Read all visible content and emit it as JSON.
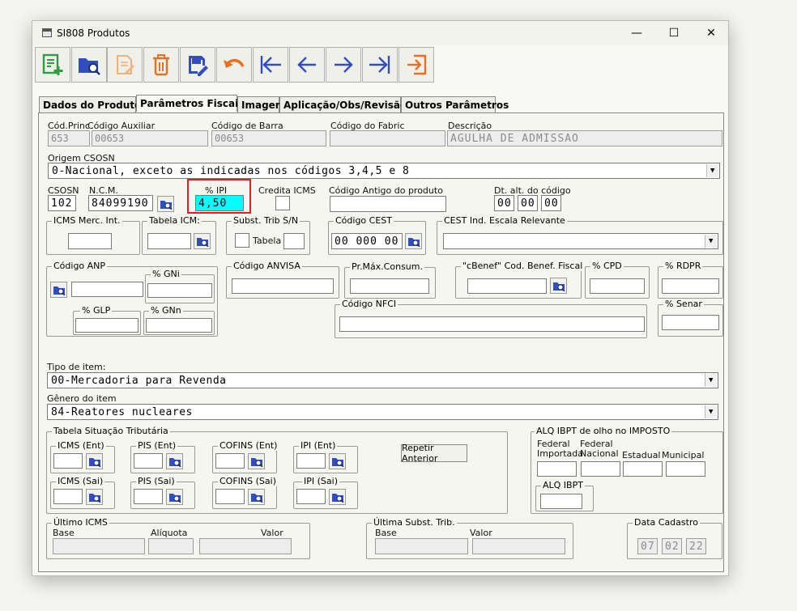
{
  "window": {
    "title": "SI808 Produtos",
    "minimize": "—",
    "maximize": "☐",
    "close": "✕"
  },
  "toolbar": {
    "buttons": [
      "new-record",
      "search-record",
      "edit-record",
      "delete-record",
      "save-record",
      "undo",
      "first-record",
      "previous-record",
      "next-record",
      "last-record",
      "exit"
    ]
  },
  "tabs": [
    "Dados do  Produto",
    "Parâmetros Fiscais",
    "Imagem",
    "Aplicação/Obs/Revisão",
    "Outros Parâmetros"
  ],
  "fields": {
    "cod_princ": {
      "label": "Cód.Princ",
      "value": "653"
    },
    "cod_auxiliar": {
      "label": "Código Auxiliar",
      "value": "00653"
    },
    "cod_barra": {
      "label": "Código de Barra",
      "value": "00653"
    },
    "cod_fabric": {
      "label": "Código do Fabric",
      "value": ""
    },
    "descricao": {
      "label": "Descrição",
      "value": "AGULHA DE ADMISSAO"
    },
    "origem": {
      "label": "Origem CSOSN",
      "value": "0-Nacional, exceto as indicadas nos códigos 3,4,5 e 8"
    },
    "csosn": {
      "label": "CSOSN",
      "value": "102"
    },
    "ncm": {
      "label": "N.C.M.",
      "value": "84099190"
    },
    "ipi": {
      "label": "% IPI",
      "value": "4,50"
    },
    "credita_icms": {
      "label": "Credita ICMS"
    },
    "cod_antigo": {
      "label": "Código Antigo do produto",
      "value": ""
    },
    "dt_alt": {
      "label": "Dt. alt. do código",
      "d": "00",
      "m": "00",
      "y": "00"
    },
    "icms_merc": {
      "label": "ICMS Merc. Int."
    },
    "tabela_icm": {
      "label": "Tabela ICM:"
    },
    "subst_trib": {
      "label": "Subst. Trib S/N",
      "tabela": "Tabela"
    },
    "cod_cest": {
      "label": "Código CEST",
      "value": "00 000 00"
    },
    "cest_ind": {
      "label": "CEST Ind. Escala Relevante"
    },
    "cod_anp": {
      "label": "Código ANP",
      "gni": "% GNi",
      "glp": "% GLP",
      "gnn": "% GNn"
    },
    "cod_anvisa": {
      "label": "Código ANVISA"
    },
    "pr_max": {
      "label": "Pr.Máx.Consum."
    },
    "cbenef": {
      "label": "\"cBenef\" Cod. Benef. Fiscal"
    },
    "cpd": {
      "label": "% CPD"
    },
    "rdpr": {
      "label": "% RDPR"
    },
    "senar": {
      "label": "% Senar"
    },
    "cod_nfci": {
      "label": "Código NFCI"
    },
    "tipo_item": {
      "label": "Tipo de item:",
      "value": "00-Mercadoria para Revenda"
    },
    "genero_item": {
      "label": "Gênero do item",
      "value": "84-Reatores nucleares"
    }
  },
  "tst": {
    "title": "Tabela Situação Tributária",
    "icms_ent": "ICMS (Ent)",
    "pis_ent": "PIS (Ent)",
    "cofins_ent": "COFINS (Ent)",
    "ipi_ent": "IPI (Ent)",
    "icms_sai": "ICMS (Sai)",
    "pis_sai": "PIS (Sai)",
    "cofins_sai": "COFINS (Sai)",
    "ipi_sai": "IPI (Sai)",
    "repetir": "Repetir Anterior"
  },
  "ibpt": {
    "title": "ALQ IBPT de olho no IMPOSTO",
    "federal_imp_1": "Federal",
    "federal_imp_2": "Importada",
    "federal_nac_1": "Federal",
    "federal_nac_2": "Nacional",
    "estadual": "Estadual",
    "municipal": "Municipal",
    "alq": "ALQ IBPT"
  },
  "ultimo_icms": {
    "title": "Último ICMS",
    "base": "Base",
    "aliquota": "Alíquota",
    "valor": "Valor"
  },
  "ultima_subst": {
    "title": "Última Subst. Trib.",
    "base": "Base",
    "valor": "Valor"
  },
  "cadastro": {
    "title": "Data Cadastro",
    "d": "07",
    "m": "02",
    "y": "22"
  },
  "colors": {
    "accent_green": "#2e9e3e",
    "accent_blue": "#2f4fc0",
    "accent_orange": "#e8701e",
    "highlight": "#00ffff",
    "red_box": "#e0201e"
  }
}
